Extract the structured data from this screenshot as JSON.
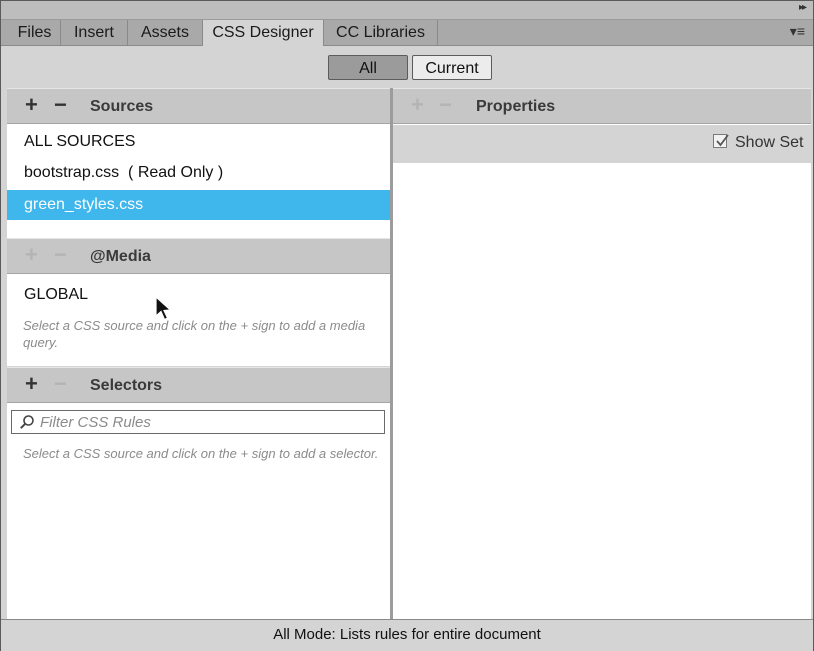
{
  "tabs": [
    {
      "label": "Files",
      "active": false
    },
    {
      "label": "Insert",
      "active": false
    },
    {
      "label": "Assets",
      "active": false
    },
    {
      "label": "CSS Designer",
      "active": true
    },
    {
      "label": "CC Libraries",
      "active": false
    }
  ],
  "mode_buttons": {
    "all": "All",
    "current": "Current",
    "selected": "all"
  },
  "sources": {
    "title": "Sources",
    "items": [
      "ALL SOURCES",
      "bootstrap.css  ( Read Only )",
      "green_styles.css"
    ],
    "selected_index": 2
  },
  "media": {
    "title": "@Media",
    "items": [
      "GLOBAL"
    ],
    "hint": "Select a CSS source and click on the + sign to add a media query."
  },
  "selectors": {
    "title": "Selectors",
    "filter_placeholder": "Filter CSS Rules",
    "hint": "Select a CSS source and click on the + sign to add a selector."
  },
  "properties": {
    "title": "Properties",
    "show_set_label": "Show Set",
    "show_set_checked": true
  },
  "status": "All Mode: Lists rules for entire document",
  "colors": {
    "selection": "#3fb6ec",
    "panel": "#d4d4d4",
    "tabbar": "#a9a9a9"
  }
}
